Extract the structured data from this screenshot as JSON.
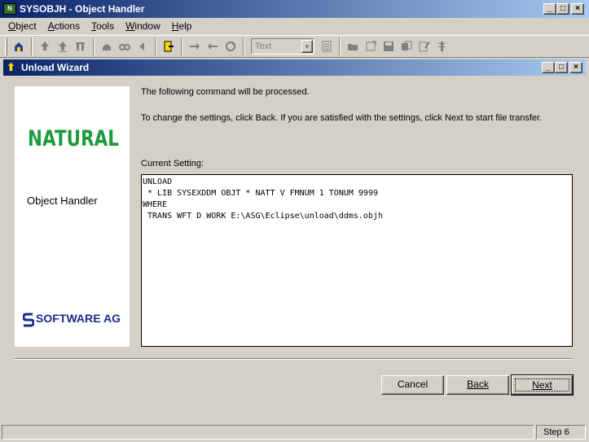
{
  "window": {
    "title": "SYSOBJH - Object Handler",
    "caption_buttons": {
      "minimize": "_",
      "maximize": "□",
      "close": "×"
    }
  },
  "menu": [
    {
      "label": "Object",
      "mnemonic": "O"
    },
    {
      "label": "Actions",
      "mnemonic": "A"
    },
    {
      "label": "Tools",
      "mnemonic": "T"
    },
    {
      "label": "Window",
      "mnemonic": "W"
    },
    {
      "label": "Help",
      "mnemonic": "H"
    }
  ],
  "toolbar": {
    "combo_value": "Text",
    "icons": [
      "wizard-icon",
      "upload-icon",
      "download-icon",
      "tools-icon",
      "library-icon",
      "find-icon",
      "back-arrow-icon",
      "exit-icon",
      "forward-icon",
      "backward-icon",
      "refresh-icon",
      "text-combo",
      "properties-icon",
      "open-folder-icon",
      "new-icon",
      "save-icon",
      "copy-icon",
      "edit-icon",
      "list-icon"
    ]
  },
  "wizard": {
    "title": "Unload Wizard",
    "branding": {
      "product_logo": "NATURAL",
      "product_name": "Object Handler",
      "vendor_logo": "SOFTWARE AG"
    },
    "info_line_1": "The following command will be processed.",
    "info_line_2": "To change the settings, click Back. If you are satisfied with the settings, click Next to start file transfer.",
    "current_setting_label": "Current Setting:",
    "command_lines": [
      "UNLOAD",
      " * LIB SYSEXDDM OBJT * NATT V FMNUM 1 TONUM 9999",
      "WHERE",
      " TRANS WFT D WORK E:\\ASG\\Eclipse\\unload\\ddms.objh"
    ],
    "buttons": {
      "cancel": "Cancel",
      "back": "Back",
      "next": "Next"
    }
  },
  "status": {
    "main_text": "",
    "step_text": "Step 6"
  }
}
